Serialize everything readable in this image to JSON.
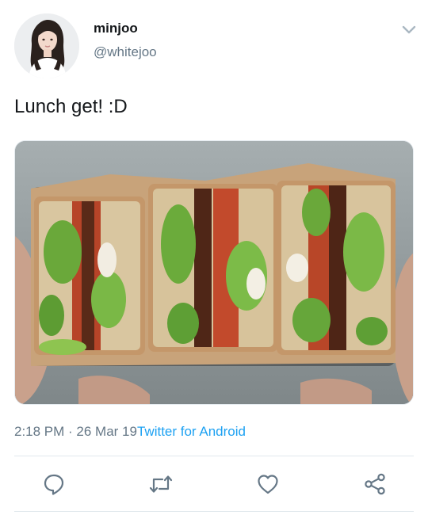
{
  "user": {
    "display_name": "minjoo",
    "handle": "@whitejoo",
    "avatar_icon": "profile-photo"
  },
  "tweet": {
    "text": "Lunch get! :D",
    "media_description_icon": "sandwich-photo",
    "time": "2:18 PM",
    "separator": " · ",
    "date": "26 Mar 19",
    "source": "Twitter for Android"
  },
  "actions": [
    {
      "name": "reply",
      "icon": "reply-icon"
    },
    {
      "name": "retweet",
      "icon": "retweet-icon"
    },
    {
      "name": "like",
      "icon": "heart-icon"
    },
    {
      "name": "share",
      "icon": "share-icon"
    }
  ],
  "colors": {
    "link": "#1da1f2",
    "secondary_text": "#657786",
    "primary_text": "#14171a",
    "icon": "#657786",
    "divider": "#e1e8ed"
  }
}
